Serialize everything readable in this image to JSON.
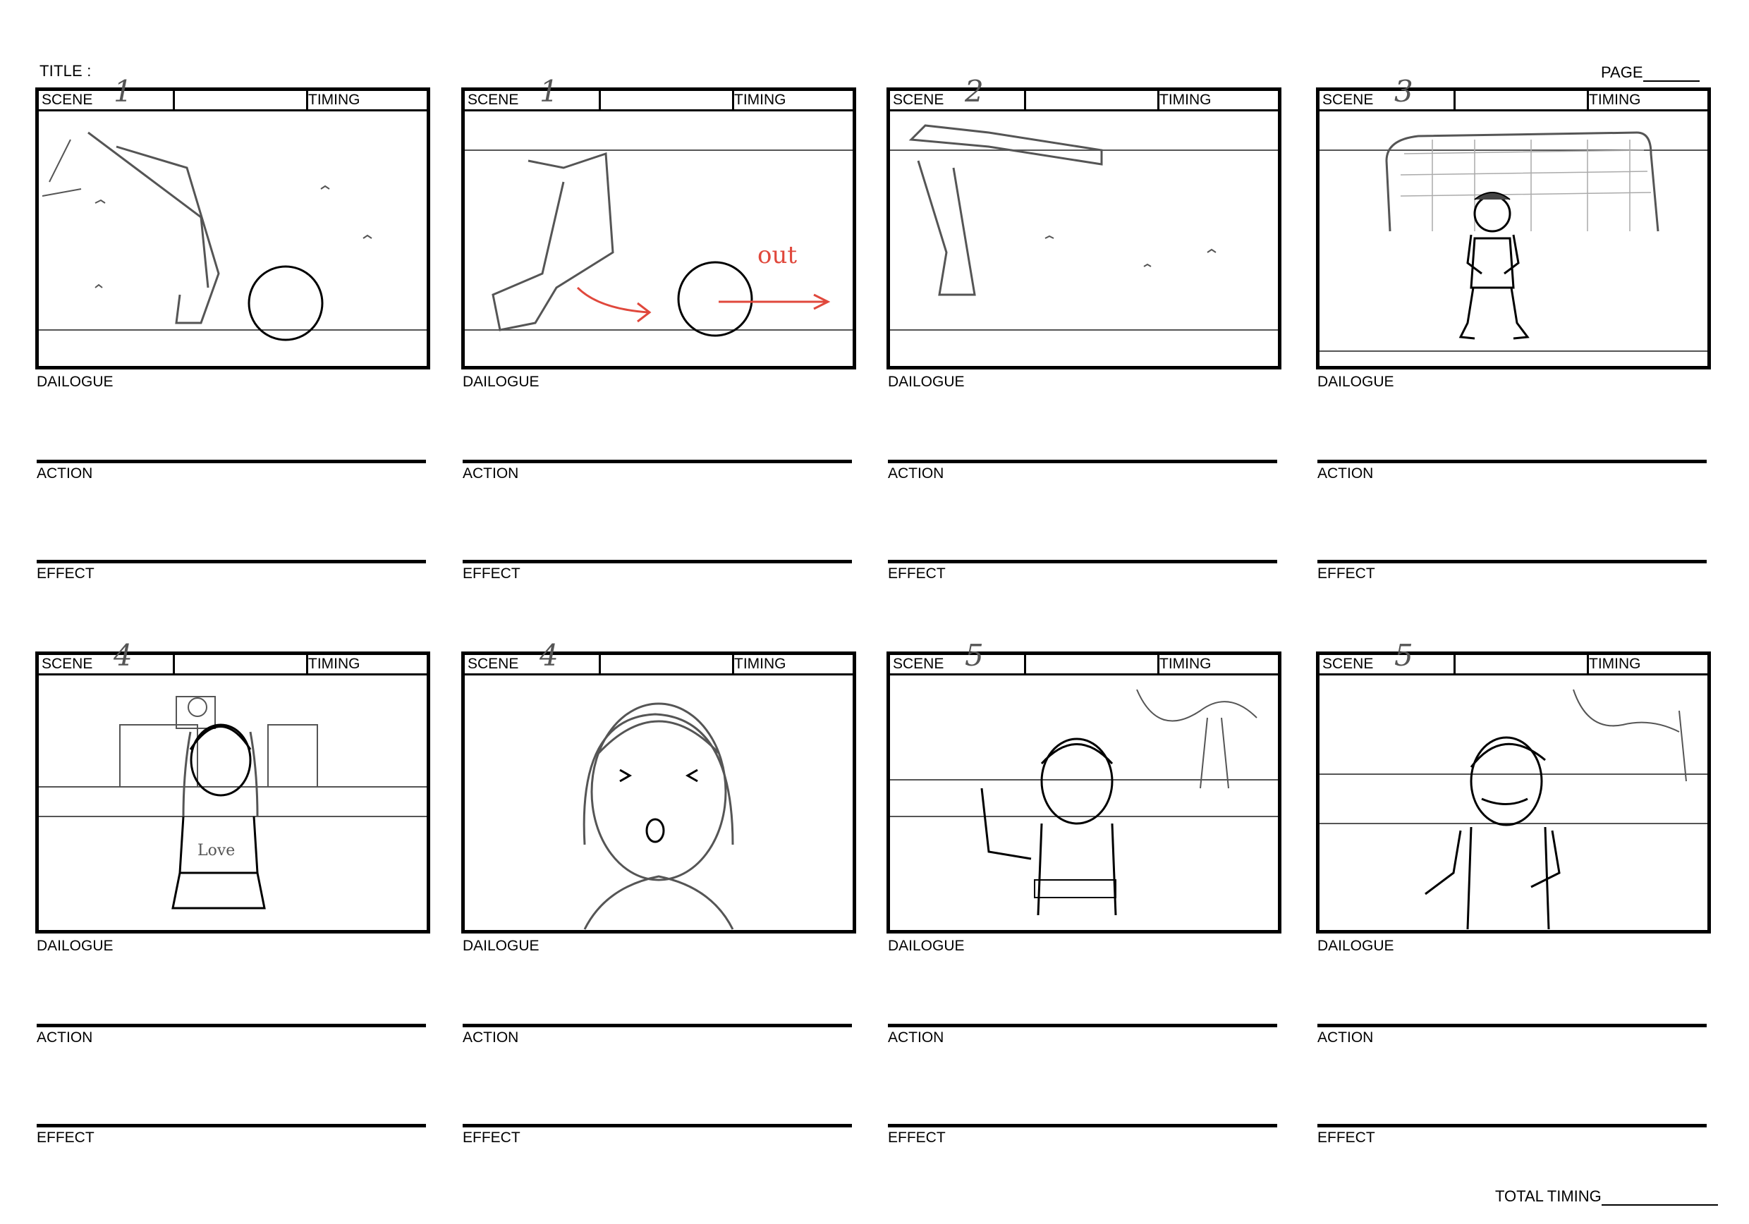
{
  "header": {
    "title_label": "TITLE :",
    "page_label": "PAGE"
  },
  "footer": {
    "total_timing_label": "TOTAL TIMING"
  },
  "field_labels": {
    "scene": "SCENE",
    "timing": "TIMING",
    "dialogue": "DAILOGUE",
    "action": "ACTION",
    "effect": "EFFECT"
  },
  "panels": [
    {
      "scene_number": "1",
      "sketch": "Leg kicking a soccer ball on a field"
    },
    {
      "scene_number": "1",
      "sketch": "Ball rolling away with red arrows",
      "note": "out"
    },
    {
      "scene_number": "2",
      "sketch": "Leg extended in a high kick"
    },
    {
      "scene_number": "3",
      "sketch": "Goalkeeper standing in front of goal"
    },
    {
      "scene_number": "4",
      "sketch": "Girl in Love shirt in front of school building"
    },
    {
      "scene_number": "4",
      "sketch": "Close-up of girl's face, eyes squeezed shut"
    },
    {
      "scene_number": "5",
      "sketch": "Girl with hand raised, annoyed look, tree behind"
    },
    {
      "scene_number": "5",
      "sketch": "Angry girl with clenched fists"
    }
  ],
  "colors": {
    "ink": "#000000",
    "pencil": "#555555",
    "annotation_red": "#e0483c"
  }
}
